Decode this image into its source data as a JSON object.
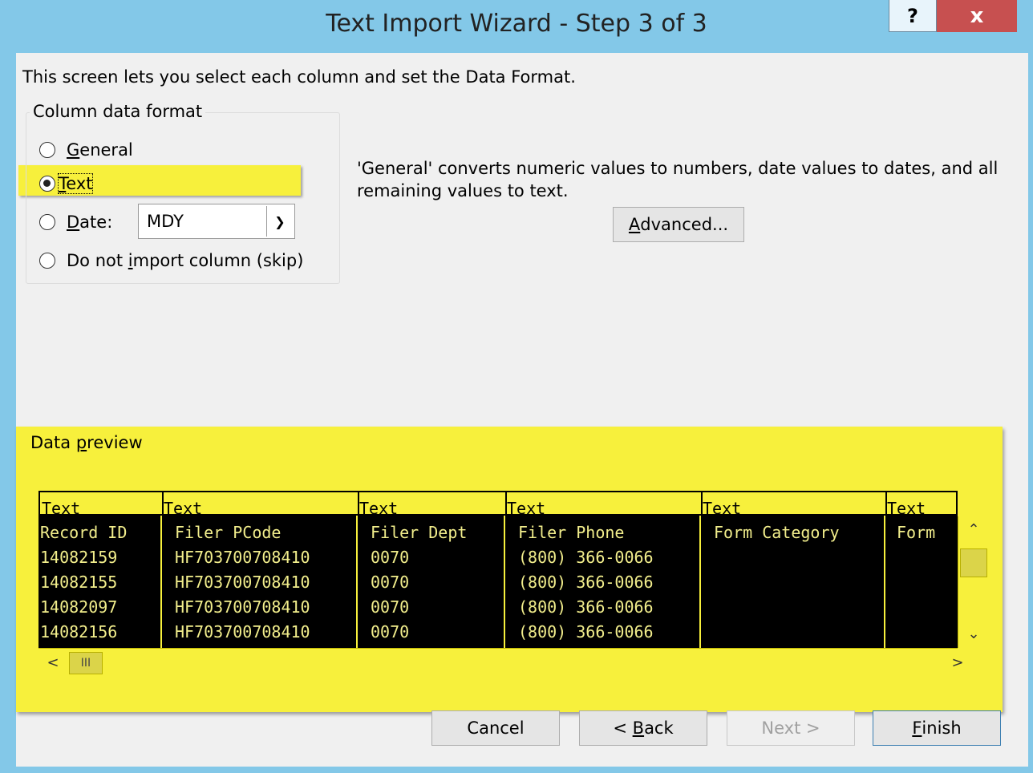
{
  "window": {
    "title": "Text Import Wizard - Step 3 of 3",
    "help_label": "?",
    "close_label": "x"
  },
  "intro": "This screen lets you select each column and set the Data Format.",
  "column_format": {
    "legend": "Column data format",
    "options": [
      {
        "pre": "",
        "u": "G",
        "post": "eneral",
        "checked": false
      },
      {
        "pre": "",
        "u": "T",
        "post": "ext",
        "checked": true
      },
      {
        "pre": "",
        "u": "D",
        "post": "ate:",
        "checked": false
      },
      {
        "pre": "Do not ",
        "u": "i",
        "post": "mport column (skip)",
        "checked": false
      }
    ],
    "date_value": "MDY"
  },
  "description": "'General' converts numeric values to numbers, date values to dates, and all remaining values to text.",
  "advanced_button": {
    "u": "A",
    "rest": "dvanced..."
  },
  "preview": {
    "legend_pre": "Data ",
    "legend_u": "p",
    "legend_post": "review",
    "formats": [
      "Text",
      "Text",
      "Text",
      "Text",
      "Text",
      "Text"
    ],
    "rows": [
      [
        "Record ID",
        "Filer PCode",
        "Filer Dept",
        "Filer Phone",
        "Form Category",
        "Form"
      ],
      [
        "14082159",
        "HF703700708410",
        "0070",
        "(800) 366-0066",
        "",
        ""
      ],
      [
        "14082155",
        "HF703700708410",
        "0070",
        "(800) 366-0066",
        "",
        ""
      ],
      [
        "14082097",
        "HF703700708410",
        "0070",
        "(800) 366-0066",
        "",
        ""
      ],
      [
        "14082156",
        "HF703700708410",
        "0070",
        "(800) 366-0066",
        "",
        ""
      ]
    ],
    "hscroll_thumb": "III"
  },
  "buttons": {
    "cancel": "Cancel",
    "back_pre": "< ",
    "back_u": "B",
    "back_post": "ack",
    "next": "Next >",
    "finish_u": "F",
    "finish_post": "inish"
  },
  "colors": {
    "highlight": "#f7f03c",
    "title_bar": "#83c8e8",
    "close": "#c75050",
    "grid_bg": "#000000"
  }
}
